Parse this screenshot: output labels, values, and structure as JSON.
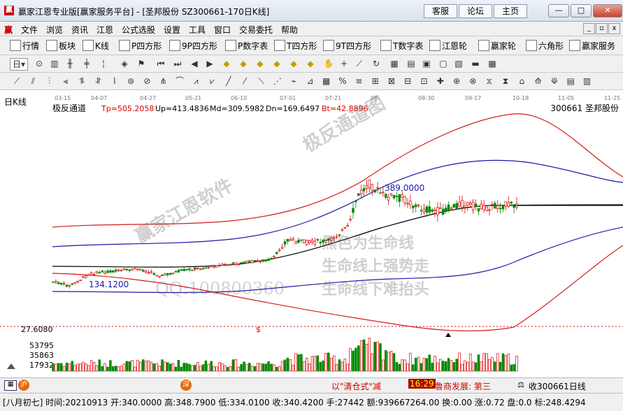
{
  "window": {
    "title": "赢家江恩专业版[赢家服务平台] - [圣邦股份  SZ300661-170日K线]",
    "links": [
      "客服",
      "论坛",
      "主页"
    ],
    "controls": [
      "—",
      "□",
      "✕"
    ]
  },
  "menu": [
    "文件",
    "浏览",
    "资讯",
    "江恩",
    "公式选股",
    "设置",
    "工具",
    "窗口",
    "交易委托",
    "帮助"
  ],
  "toolbar1": [
    "行情",
    "板块",
    "K线",
    "P四方形",
    "9P四方形",
    "P数字表",
    "T四方形",
    "9T四方形",
    "T数字表",
    "江恩轮",
    "赢家轮",
    "六角形",
    "赢家服务"
  ],
  "toolbar1_icons": [
    "grid-icon",
    "blocks-icon",
    "candles-icon",
    "ps-icon",
    "9ps-icon",
    "pn-icon",
    "ts-icon",
    "9ts-icon",
    "tn-icon",
    "wheel-icon",
    "yj-icon",
    "hexagon-icon",
    "money-icon"
  ],
  "toolbar2_first": "日",
  "chart": {
    "period_label": "日K线",
    "indicator": {
      "name": "极反通道",
      "tp": "Tp=505.2058",
      "up": "Up=413.4836",
      "md": "Md=309.5982",
      "dn": "Dn=169.6497",
      "bt": "Bt=42.8896"
    },
    "stock": "300661  圣邦股份",
    "dates": [
      "03-15",
      "04-07",
      "04-27",
      "05-21",
      "06-10",
      "07-01",
      "07-21",
      "08-",
      "08-30",
      "09-17",
      "10-18",
      "11-05",
      "11-25"
    ],
    "high_label": "389.0000",
    "low_label": "134.1200",
    "watermarks": {
      "w1": "赢家江恩软件",
      "w2": "极反通道图",
      "w3": "黑色为生命线",
      "w4": "生命线上强势走",
      "w5": "生命线下难抬头",
      "qq": "QQ:100800360"
    },
    "colors": {
      "up": "#e00000",
      "down": "#008800",
      "outer": "#d41c1c",
      "inner": "#1a1aa6",
      "mid": "#000000"
    },
    "volume": {
      "top_value": "27.6080",
      "v1": "53795",
      "v2": "35863",
      "v3": "17932",
      "marker": "$"
    }
  },
  "status": {
    "ticker": "以\"清仓式\"减",
    "time": "16:29",
    "news": "鲁商发展: 第三",
    "right": "收300661日线"
  },
  "info": "[八月初七] 时间:20210913 开:340.0000 高:348.7900 低:334.0100 收:340.4200 手:27442 额:939667264.00 换:0.00 涨:0.72 盘:0.0 标:248.4294"
}
